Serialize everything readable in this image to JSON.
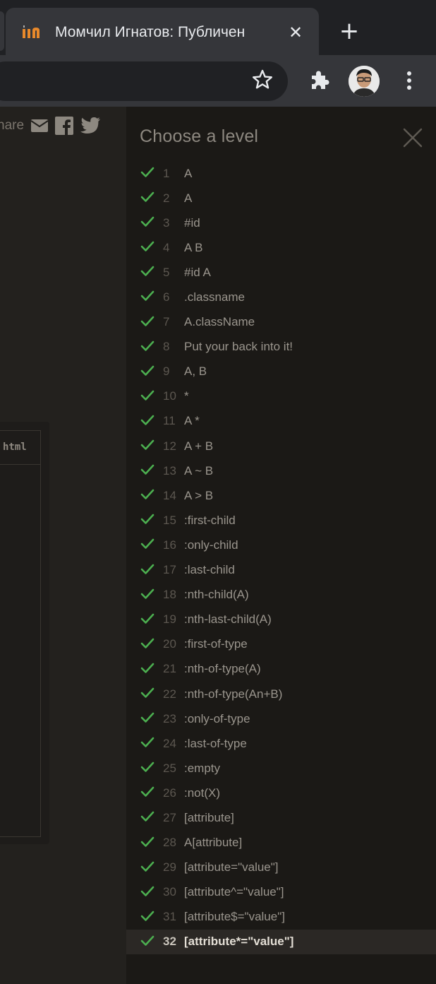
{
  "browser": {
    "tab_title": "Момчил Игнатов: Публичен",
    "close_tab_label": "✕",
    "new_tab_label": "+",
    "favicon": "github-mona-icon",
    "toolbar_icons": [
      "bookmark-star-icon",
      "extensions-puzzle-icon",
      "profile-avatar",
      "menu-dots-icon"
    ]
  },
  "page": {
    "share_label": "hare",
    "share_icons": [
      "email-icon",
      "facebook-icon",
      "twitter-icon"
    ],
    "editor_lang": "html"
  },
  "level_panel": {
    "title": "Choose a level",
    "close_icon": "close-x-icon",
    "check_color": "#4caf50",
    "current_level": 32,
    "levels": [
      {
        "num": "1",
        "name": "A",
        "completed": true
      },
      {
        "num": "2",
        "name": "A",
        "completed": true
      },
      {
        "num": "3",
        "name": "#id",
        "completed": true
      },
      {
        "num": "4",
        "name": "A B",
        "completed": true
      },
      {
        "num": "5",
        "name": "#id A",
        "completed": true
      },
      {
        "num": "6",
        "name": ".classname",
        "completed": true
      },
      {
        "num": "7",
        "name": "A.className",
        "completed": true
      },
      {
        "num": "8",
        "name": "Put your back into it!",
        "completed": true
      },
      {
        "num": "9",
        "name": "A, B",
        "completed": true
      },
      {
        "num": "10",
        "name": "*",
        "completed": true
      },
      {
        "num": "11",
        "name": "A *",
        "completed": true
      },
      {
        "num": "12",
        "name": "A + B",
        "completed": true
      },
      {
        "num": "13",
        "name": "A ~ B",
        "completed": true
      },
      {
        "num": "14",
        "name": "A > B",
        "completed": true
      },
      {
        "num": "15",
        "name": ":first-child",
        "completed": true
      },
      {
        "num": "16",
        "name": ":only-child",
        "completed": true
      },
      {
        "num": "17",
        "name": ":last-child",
        "completed": true
      },
      {
        "num": "18",
        "name": ":nth-child(A)",
        "completed": true
      },
      {
        "num": "19",
        "name": ":nth-last-child(A)",
        "completed": true
      },
      {
        "num": "20",
        "name": ":first-of-type",
        "completed": true
      },
      {
        "num": "21",
        "name": ":nth-of-type(A)",
        "completed": true
      },
      {
        "num": "22",
        "name": ":nth-of-type(An+B)",
        "completed": true
      },
      {
        "num": "23",
        "name": ":only-of-type",
        "completed": true
      },
      {
        "num": "24",
        "name": ":last-of-type",
        "completed": true
      },
      {
        "num": "25",
        "name": ":empty",
        "completed": true
      },
      {
        "num": "26",
        "name": ":not(X)",
        "completed": true
      },
      {
        "num": "27",
        "name": "[attribute]",
        "completed": true
      },
      {
        "num": "28",
        "name": "A[attribute]",
        "completed": true
      },
      {
        "num": "29",
        "name": "[attribute=\"value\"]",
        "completed": true
      },
      {
        "num": "30",
        "name": "[attribute^=\"value\"]",
        "completed": true
      },
      {
        "num": "31",
        "name": "[attribute$=\"value\"]",
        "completed": true
      },
      {
        "num": "32",
        "name": "[attribute*=\"value\"]",
        "completed": true
      }
    ]
  }
}
